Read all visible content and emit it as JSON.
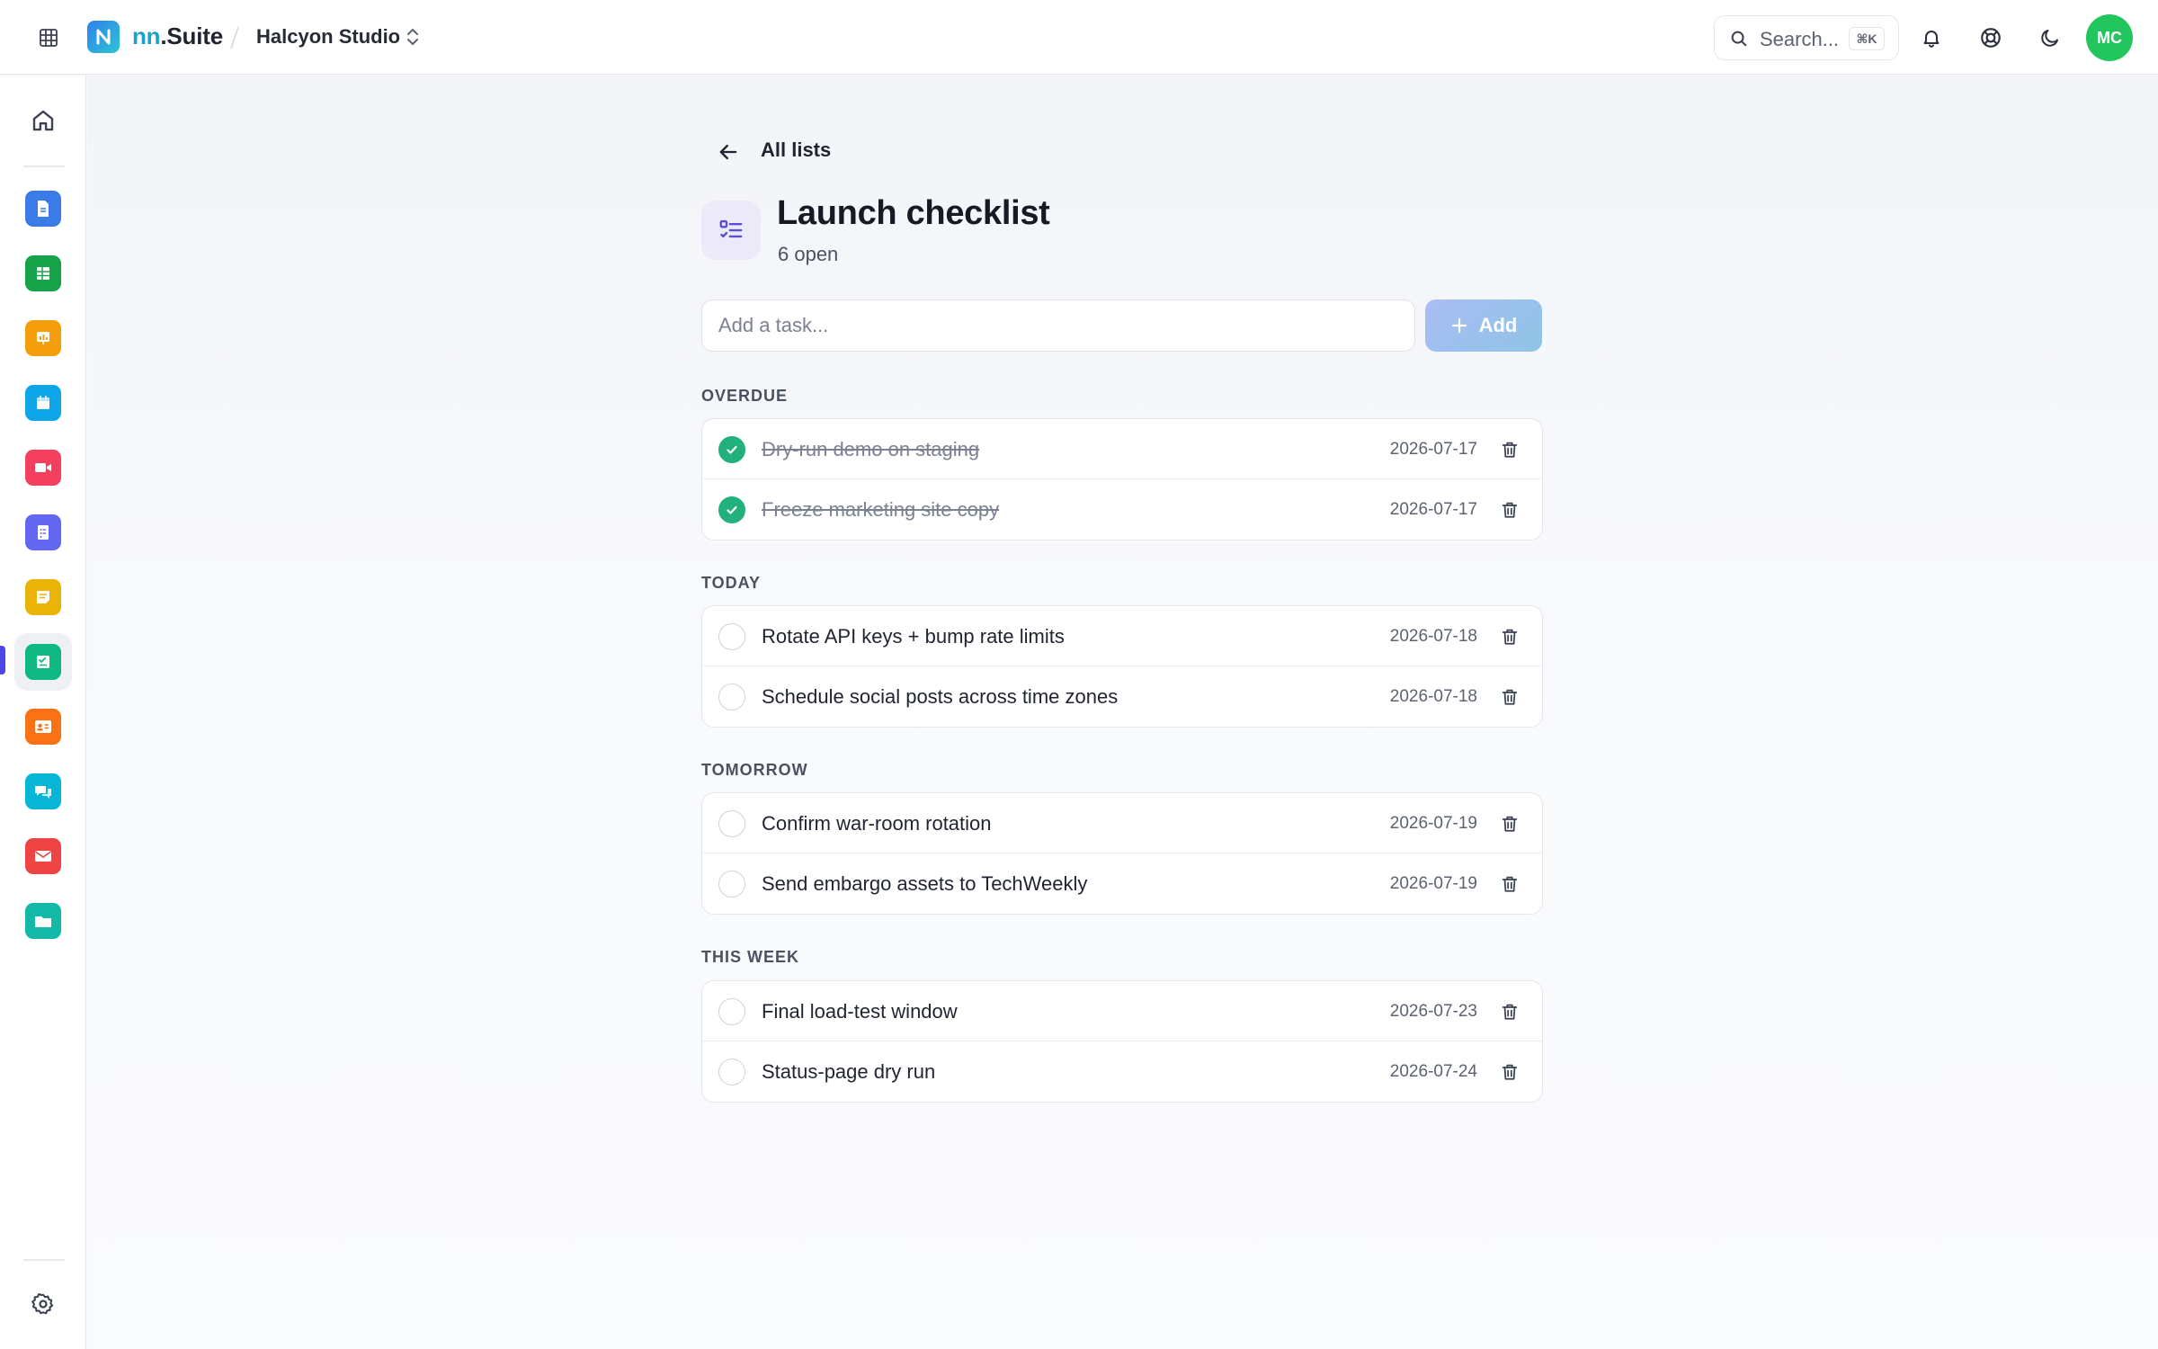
{
  "topbar": {
    "brand_prefix": "nn",
    "brand_suffix": ".Suite",
    "workspace": "Halcyon Studio",
    "search_placeholder": "Search...",
    "search_shortcut": "⌘K",
    "avatar_initials": "MC",
    "avatar_color": "#22c55e"
  },
  "sidebar": {
    "apps": [
      {
        "name": "docs",
        "color": "#3b7be8"
      },
      {
        "name": "sheets",
        "color": "#16a34a"
      },
      {
        "name": "slides",
        "color": "#f59e0b"
      },
      {
        "name": "calendar",
        "color": "#0ea5e9"
      },
      {
        "name": "meet",
        "color": "#f43f5e"
      },
      {
        "name": "forms",
        "color": "#6366f1"
      },
      {
        "name": "notes",
        "color": "#eab308"
      },
      {
        "name": "tasks",
        "color": "#10b981",
        "active": true
      },
      {
        "name": "contacts",
        "color": "#f97316"
      },
      {
        "name": "chat",
        "color": "#06b6d4"
      },
      {
        "name": "mail",
        "color": "#ef4444"
      },
      {
        "name": "drive",
        "color": "#14b8a6"
      }
    ]
  },
  "main": {
    "back_label": "All lists",
    "title": "Launch checklist",
    "subtitle": "6 open",
    "add_placeholder": "Add a task...",
    "add_label": "Add",
    "sections": [
      {
        "label": "OVERDUE",
        "tasks": [
          {
            "text": "Dry-run demo on staging",
            "date": "2026-07-17",
            "done": true
          },
          {
            "text": "Freeze marketing site copy",
            "date": "2026-07-17",
            "done": true
          }
        ]
      },
      {
        "label": "TODAY",
        "tasks": [
          {
            "text": "Rotate API keys + bump rate limits",
            "date": "2026-07-18",
            "done": false
          },
          {
            "text": "Schedule social posts across time zones",
            "date": "2026-07-18",
            "done": false
          }
        ]
      },
      {
        "label": "TOMORROW",
        "tasks": [
          {
            "text": "Confirm war-room rotation",
            "date": "2026-07-19",
            "done": false
          },
          {
            "text": "Send embargo assets to TechWeekly",
            "date": "2026-07-19",
            "done": false
          }
        ]
      },
      {
        "label": "THIS WEEK",
        "tasks": [
          {
            "text": "Final load-test window",
            "date": "2026-07-23",
            "done": false
          },
          {
            "text": "Status-page dry run",
            "date": "2026-07-24",
            "done": false
          }
        ]
      }
    ]
  }
}
